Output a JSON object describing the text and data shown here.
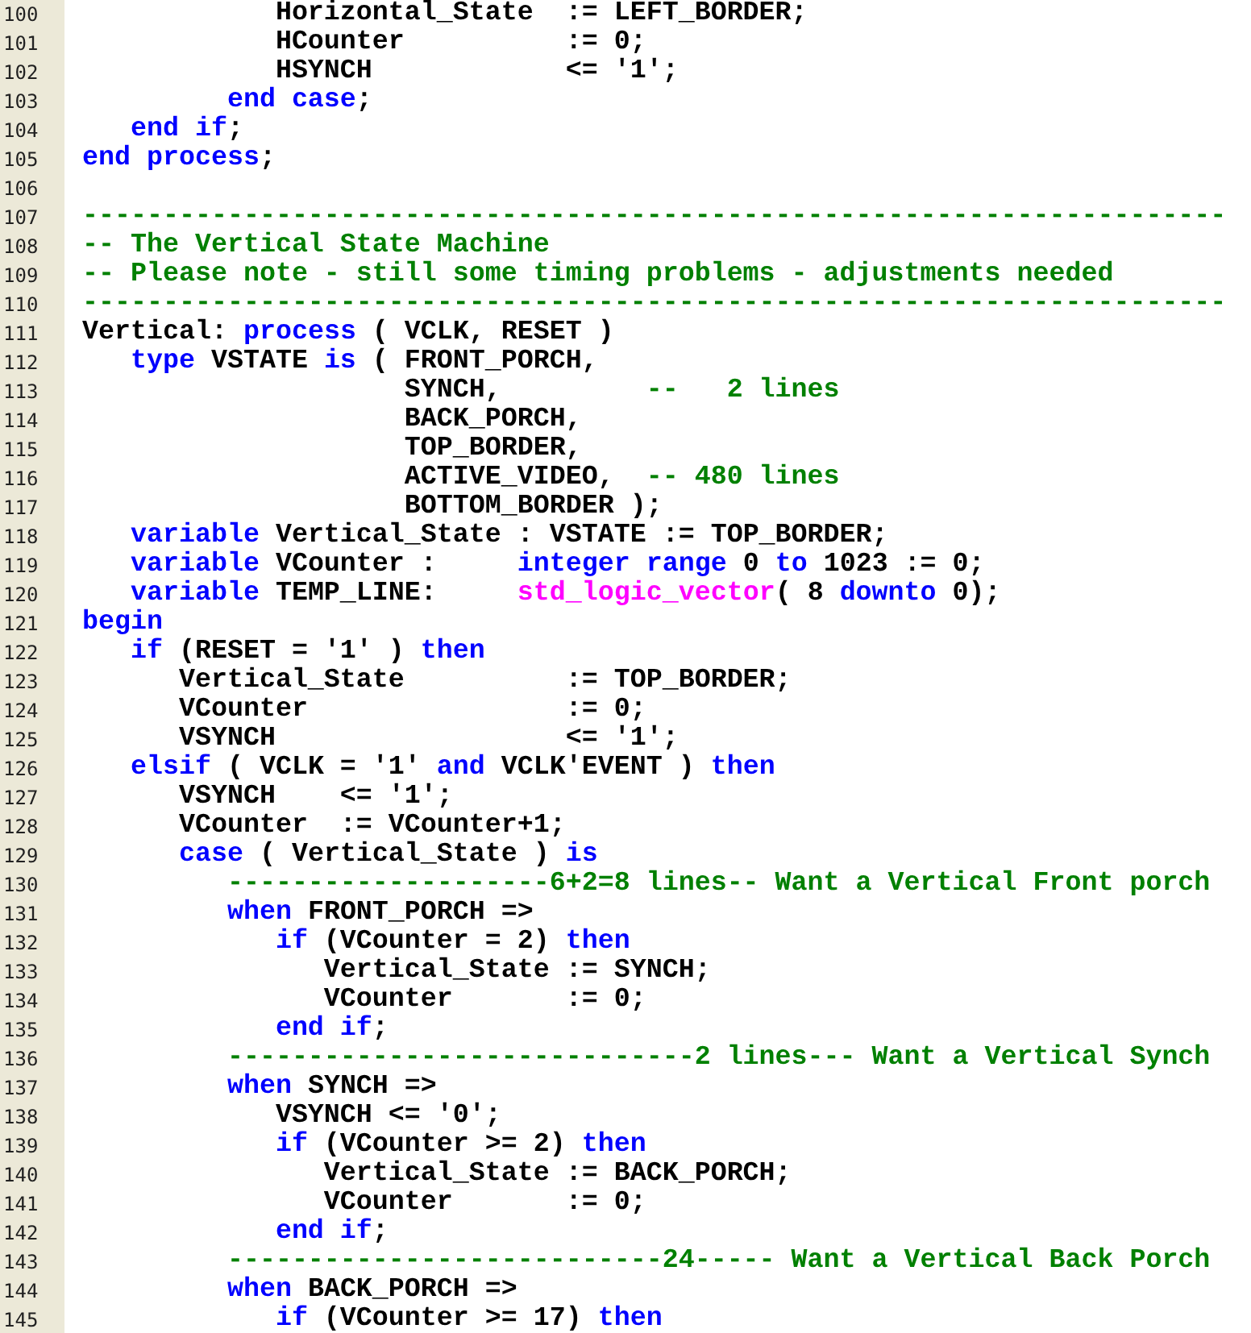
{
  "lines": [
    {
      "number": "100",
      "tokens": [
        {
          "kind": "text",
          "text": "            Horizontal_State  := LEFT_BORDER;"
        }
      ]
    },
    {
      "number": "101",
      "tokens": [
        {
          "kind": "text",
          "text": "            HCounter          := 0;"
        }
      ]
    },
    {
      "number": "102",
      "tokens": [
        {
          "kind": "text",
          "text": "            HSYNCH            <= '1';"
        }
      ]
    },
    {
      "number": "103",
      "tokens": [
        {
          "kind": "keyword",
          "text": "         end case"
        },
        {
          "kind": "text",
          "text": ";"
        }
      ]
    },
    {
      "number": "104",
      "tokens": [
        {
          "kind": "keyword",
          "text": "   end if"
        },
        {
          "kind": "text",
          "text": ";"
        }
      ]
    },
    {
      "number": "105",
      "tokens": [
        {
          "kind": "keyword",
          "text": "end process"
        },
        {
          "kind": "text",
          "text": ";"
        }
      ]
    },
    {
      "number": "106"
    },
    {
      "number": "107",
      "tokens": [
        {
          "kind": "comment",
          "text": "-----------------------------------------------------------------------"
        }
      ]
    },
    {
      "number": "108",
      "tokens": [
        {
          "kind": "comment",
          "text": "-- The Vertical State Machine"
        }
      ]
    },
    {
      "number": "109",
      "tokens": [
        {
          "kind": "comment",
          "text": "-- Please note - still some timing problems - adjustments needed"
        }
      ]
    },
    {
      "number": "110",
      "tokens": [
        {
          "kind": "comment",
          "text": "-----------------------------------------------------------------------"
        }
      ]
    },
    {
      "number": "111",
      "tokens": [
        {
          "kind": "text",
          "text": "Vertical: "
        },
        {
          "kind": "keyword",
          "text": "process"
        },
        {
          "kind": "text",
          "text": " ( VCLK, RESET )"
        }
      ]
    },
    {
      "number": "112",
      "tokens": [
        {
          "kind": "keyword",
          "text": "   type"
        },
        {
          "kind": "text",
          "text": " VSTATE "
        },
        {
          "kind": "keyword",
          "text": "is"
        },
        {
          "kind": "text",
          "text": " ( FRONT_PORCH,"
        }
      ]
    },
    {
      "number": "113",
      "tokens": [
        {
          "kind": "text",
          "text": "                    SYNCH,         "
        },
        {
          "kind": "comment",
          "text": "--   2 lines"
        }
      ]
    },
    {
      "number": "114",
      "tokens": [
        {
          "kind": "text",
          "text": "                    BACK_PORCH,"
        }
      ]
    },
    {
      "number": "115",
      "tokens": [
        {
          "kind": "text",
          "text": "                    TOP_BORDER,"
        }
      ]
    },
    {
      "number": "116",
      "tokens": [
        {
          "kind": "text",
          "text": "                    ACTIVE_VIDEO,  "
        },
        {
          "kind": "comment",
          "text": "-- 480 lines"
        }
      ]
    },
    {
      "number": "117",
      "tokens": [
        {
          "kind": "text",
          "text": "                    BOTTOM_BORDER );"
        }
      ]
    },
    {
      "number": "118",
      "tokens": [
        {
          "kind": "keyword",
          "text": "   variable"
        },
        {
          "kind": "text",
          "text": " Vertical_State : VSTATE := TOP_BORDER;"
        }
      ]
    },
    {
      "number": "119",
      "tokens": [
        {
          "kind": "keyword",
          "text": "   variable"
        },
        {
          "kind": "text",
          "text": " VCounter :     "
        },
        {
          "kind": "keyword",
          "text": "integer range"
        },
        {
          "kind": "text",
          "text": " 0 "
        },
        {
          "kind": "keyword",
          "text": "to"
        },
        {
          "kind": "text",
          "text": " 1023 := 0;"
        }
      ]
    },
    {
      "number": "120",
      "tokens": [
        {
          "kind": "keyword",
          "text": "   variable"
        },
        {
          "kind": "text",
          "text": " TEMP_LINE:     "
        },
        {
          "kind": "type",
          "text": "std_logic_vector"
        },
        {
          "kind": "text",
          "text": "( 8 "
        },
        {
          "kind": "keyword",
          "text": "downto"
        },
        {
          "kind": "text",
          "text": " 0);"
        }
      ]
    },
    {
      "number": "121",
      "tokens": [
        {
          "kind": "keyword",
          "text": "begin"
        }
      ]
    },
    {
      "number": "122",
      "tokens": [
        {
          "kind": "keyword",
          "text": "   if"
        },
        {
          "kind": "text",
          "text": " (RESET = '1' ) "
        },
        {
          "kind": "keyword",
          "text": "then"
        }
      ]
    },
    {
      "number": "123",
      "tokens": [
        {
          "kind": "text",
          "text": "      Vertical_State          := TOP_BORDER;"
        }
      ]
    },
    {
      "number": "124",
      "tokens": [
        {
          "kind": "text",
          "text": "      VCounter                := 0;"
        }
      ]
    },
    {
      "number": "125",
      "tokens": [
        {
          "kind": "text",
          "text": "      VSYNCH                  <= '1';"
        }
      ]
    },
    {
      "number": "126",
      "tokens": [
        {
          "kind": "keyword",
          "text": "   elsif"
        },
        {
          "kind": "text",
          "text": " ( VCLK = '1' "
        },
        {
          "kind": "keyword",
          "text": "and"
        },
        {
          "kind": "text",
          "text": " VCLK'EVENT ) "
        },
        {
          "kind": "keyword",
          "text": "then"
        }
      ]
    },
    {
      "number": "127",
      "tokens": [
        {
          "kind": "text",
          "text": "      VSYNCH    <= '1';"
        }
      ]
    },
    {
      "number": "128",
      "tokens": [
        {
          "kind": "text",
          "text": "      VCounter  := VCounter+1;"
        }
      ]
    },
    {
      "number": "129",
      "tokens": [
        {
          "kind": "keyword",
          "text": "      case"
        },
        {
          "kind": "text",
          "text": " ( Vertical_State ) "
        },
        {
          "kind": "keyword",
          "text": "is"
        }
      ]
    },
    {
      "number": "130",
      "tokens": [
        {
          "kind": "comment",
          "text": "         --------------------6+2=8 lines-- Want a Vertical Front porch"
        }
      ]
    },
    {
      "number": "131",
      "tokens": [
        {
          "kind": "keyword",
          "text": "         when"
        },
        {
          "kind": "text",
          "text": " FRONT_PORCH =>"
        }
      ]
    },
    {
      "number": "132",
      "tokens": [
        {
          "kind": "keyword",
          "text": "            if"
        },
        {
          "kind": "text",
          "text": " (VCounter = 2) "
        },
        {
          "kind": "keyword",
          "text": "then"
        }
      ]
    },
    {
      "number": "133",
      "tokens": [
        {
          "kind": "text",
          "text": "               Vertical_State := SYNCH;"
        }
      ]
    },
    {
      "number": "134",
      "tokens": [
        {
          "kind": "text",
          "text": "               VCounter       := 0;"
        }
      ]
    },
    {
      "number": "135",
      "tokens": [
        {
          "kind": "keyword",
          "text": "            end if"
        },
        {
          "kind": "text",
          "text": ";"
        }
      ]
    },
    {
      "number": "136",
      "tokens": [
        {
          "kind": "comment",
          "text": "         -----------------------------2 lines--- Want a Vertical Synch"
        }
      ]
    },
    {
      "number": "137",
      "tokens": [
        {
          "kind": "keyword",
          "text": "         when"
        },
        {
          "kind": "text",
          "text": " SYNCH =>"
        }
      ]
    },
    {
      "number": "138",
      "tokens": [
        {
          "kind": "text",
          "text": "            VSYNCH <= '0';"
        }
      ]
    },
    {
      "number": "139",
      "tokens": [
        {
          "kind": "keyword",
          "text": "            if"
        },
        {
          "kind": "text",
          "text": " (VCounter >= 2) "
        },
        {
          "kind": "keyword",
          "text": "then"
        }
      ]
    },
    {
      "number": "140",
      "tokens": [
        {
          "kind": "text",
          "text": "               Vertical_State := BACK_PORCH;"
        }
      ]
    },
    {
      "number": "141",
      "tokens": [
        {
          "kind": "text",
          "text": "               VCounter       := 0;"
        }
      ]
    },
    {
      "number": "142",
      "tokens": [
        {
          "kind": "keyword",
          "text": "            end if"
        },
        {
          "kind": "text",
          "text": ";"
        }
      ]
    },
    {
      "number": "143",
      "tokens": [
        {
          "kind": "comment",
          "text": "         ---------------------------24----- Want a Vertical Back Porch"
        }
      ]
    },
    {
      "number": "144",
      "tokens": [
        {
          "kind": "keyword",
          "text": "         when"
        },
        {
          "kind": "text",
          "text": " BACK_PORCH =>"
        }
      ]
    },
    {
      "number": "145",
      "tokens": [
        {
          "kind": "keyword",
          "text": "            if"
        },
        {
          "kind": "text",
          "text": " (VCounter >= 17) "
        },
        {
          "kind": "keyword",
          "text": "then"
        }
      ]
    }
  ]
}
